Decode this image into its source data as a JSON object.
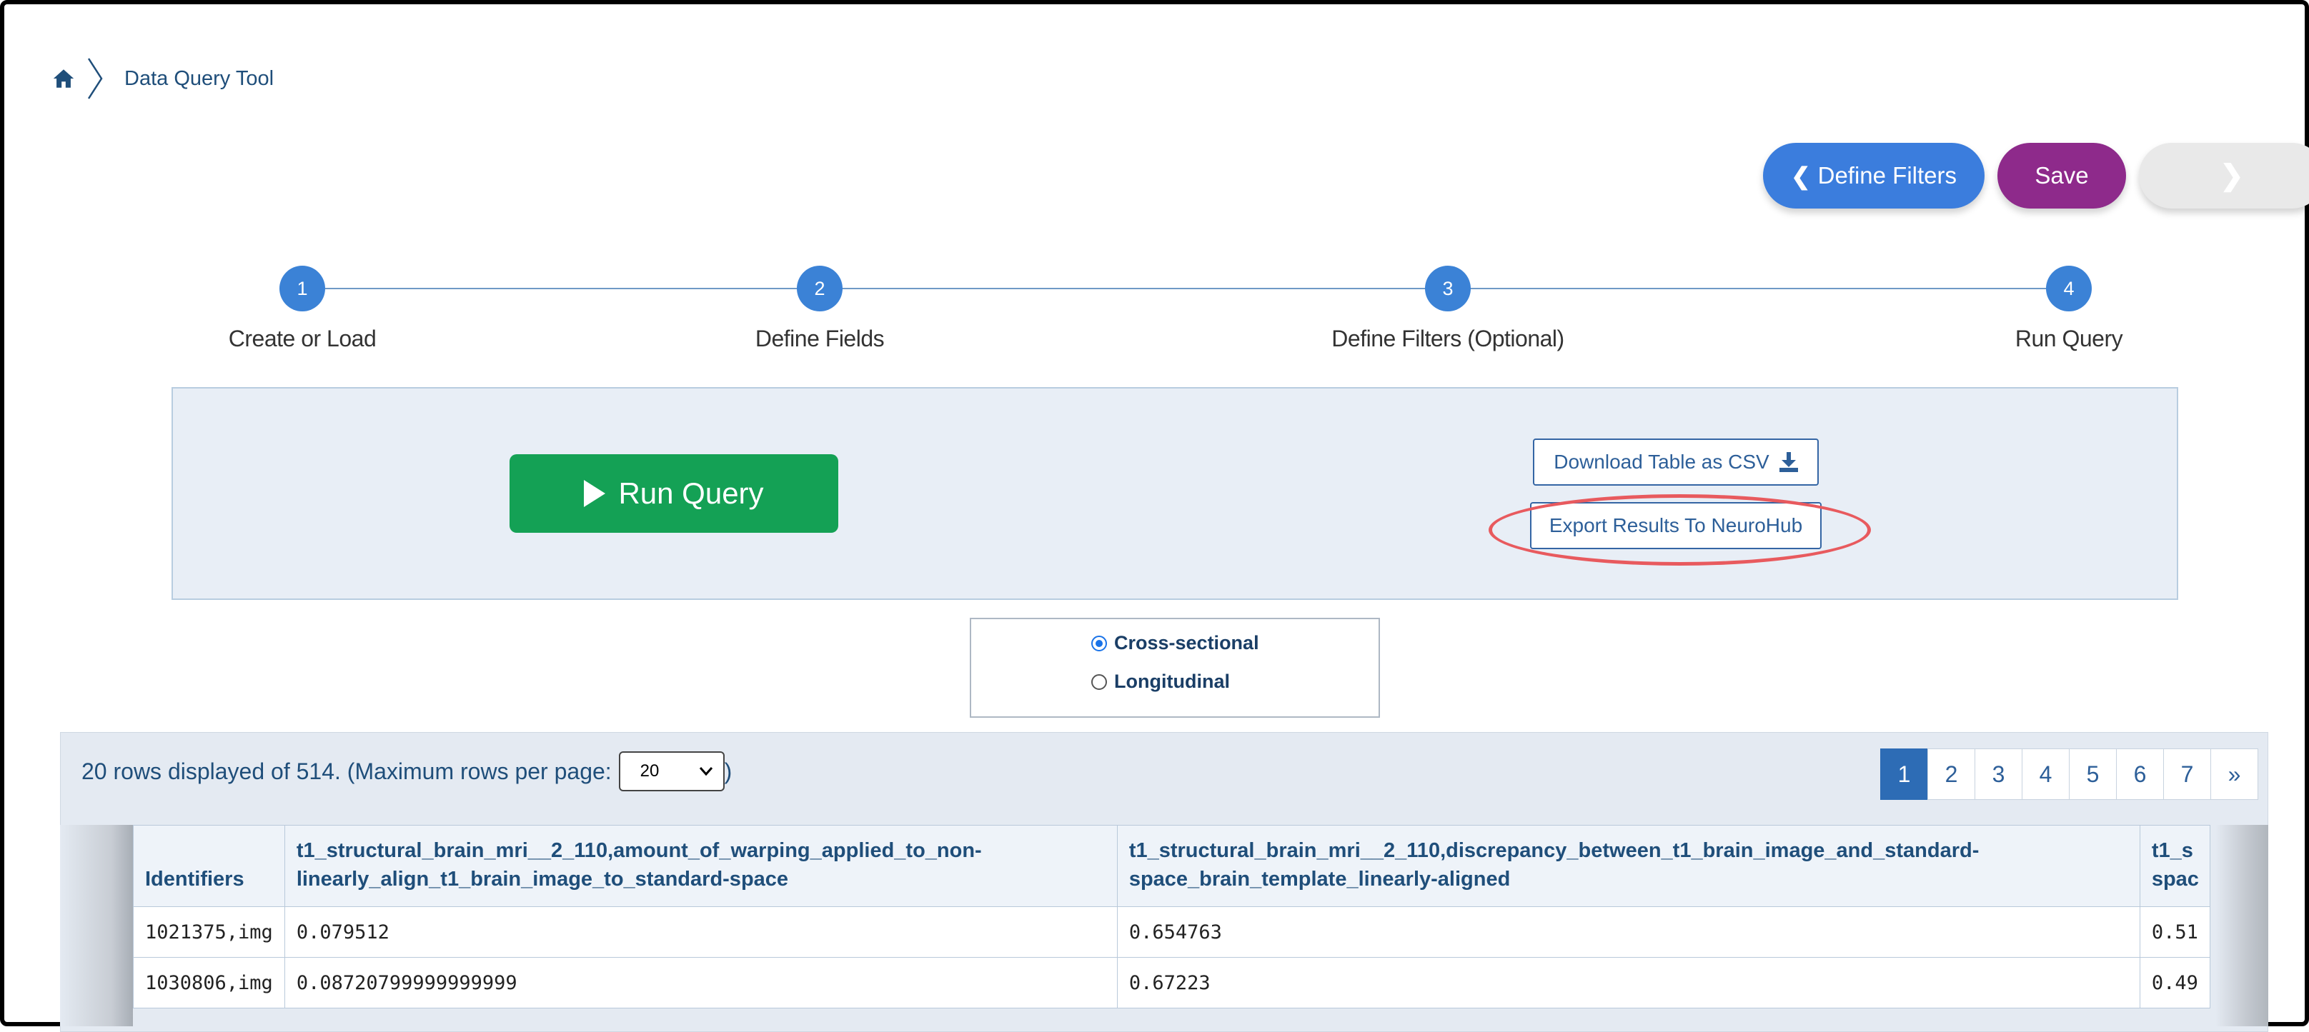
{
  "breadcrumb": {
    "home_icon": "home-icon",
    "current": "Data Query Tool"
  },
  "nav": {
    "define_filters": "Define Filters",
    "save": "Save",
    "next_icon": "chevron-right-icon"
  },
  "steps": [
    {
      "number": "1",
      "label": "Create or Load"
    },
    {
      "number": "2",
      "label": "Define Fields"
    },
    {
      "number": "3",
      "label": "Define Filters (Optional)"
    },
    {
      "number": "4",
      "label": "Run Query"
    }
  ],
  "actions": {
    "run_query": "Run Query",
    "download_csv": "Download Table as CSV",
    "export_neurohub": "Export Results To NeuroHub"
  },
  "view_mode": {
    "selected": "Cross-sectional",
    "options": [
      "Cross-sectional",
      "Longitudinal"
    ]
  },
  "results": {
    "rows_info": "20 rows displayed of 514. (Maximum rows per page:",
    "rows_info_close": ")",
    "rows_per_page": "20",
    "pages": [
      "1",
      "2",
      "3",
      "4",
      "5",
      "6",
      "7",
      "»"
    ],
    "active_page": "1",
    "columns": [
      "Identifiers",
      "t1_structural_brain_mri__2_110,amount_of_warping_applied_to_non-linearly_align_t1_brain_image_to_standard-space",
      "t1_structural_brain_mri__2_110,discrepancy_between_t1_brain_image_and_standard-space_brain_template_linearly-aligned",
      "t1_s spac"
    ],
    "column_lines": [
      [
        "Identifiers"
      ],
      [
        "t1_structural_brain_mri__2_110,amount_of_warping_applied_to_non-",
        "linearly_align_t1_brain_image_to_standard-space"
      ],
      [
        "t1_structural_brain_mri__2_110,discrepancy_between_t1_brain_image_and_standard-",
        "space_brain_template_linearly-aligned"
      ],
      [
        "t1_s",
        "spac"
      ]
    ],
    "rows": [
      [
        "1021375,img",
        "0.079512",
        "0.654763",
        "0.51"
      ],
      [
        "1030806,img",
        "0.08720799999999999",
        "0.67223",
        "0.49"
      ]
    ]
  },
  "colors": {
    "primary_blue": "#3b7ddd",
    "save_purple": "#8e2a8b",
    "run_green": "#14a155",
    "highlight_red": "#e85a5e"
  }
}
